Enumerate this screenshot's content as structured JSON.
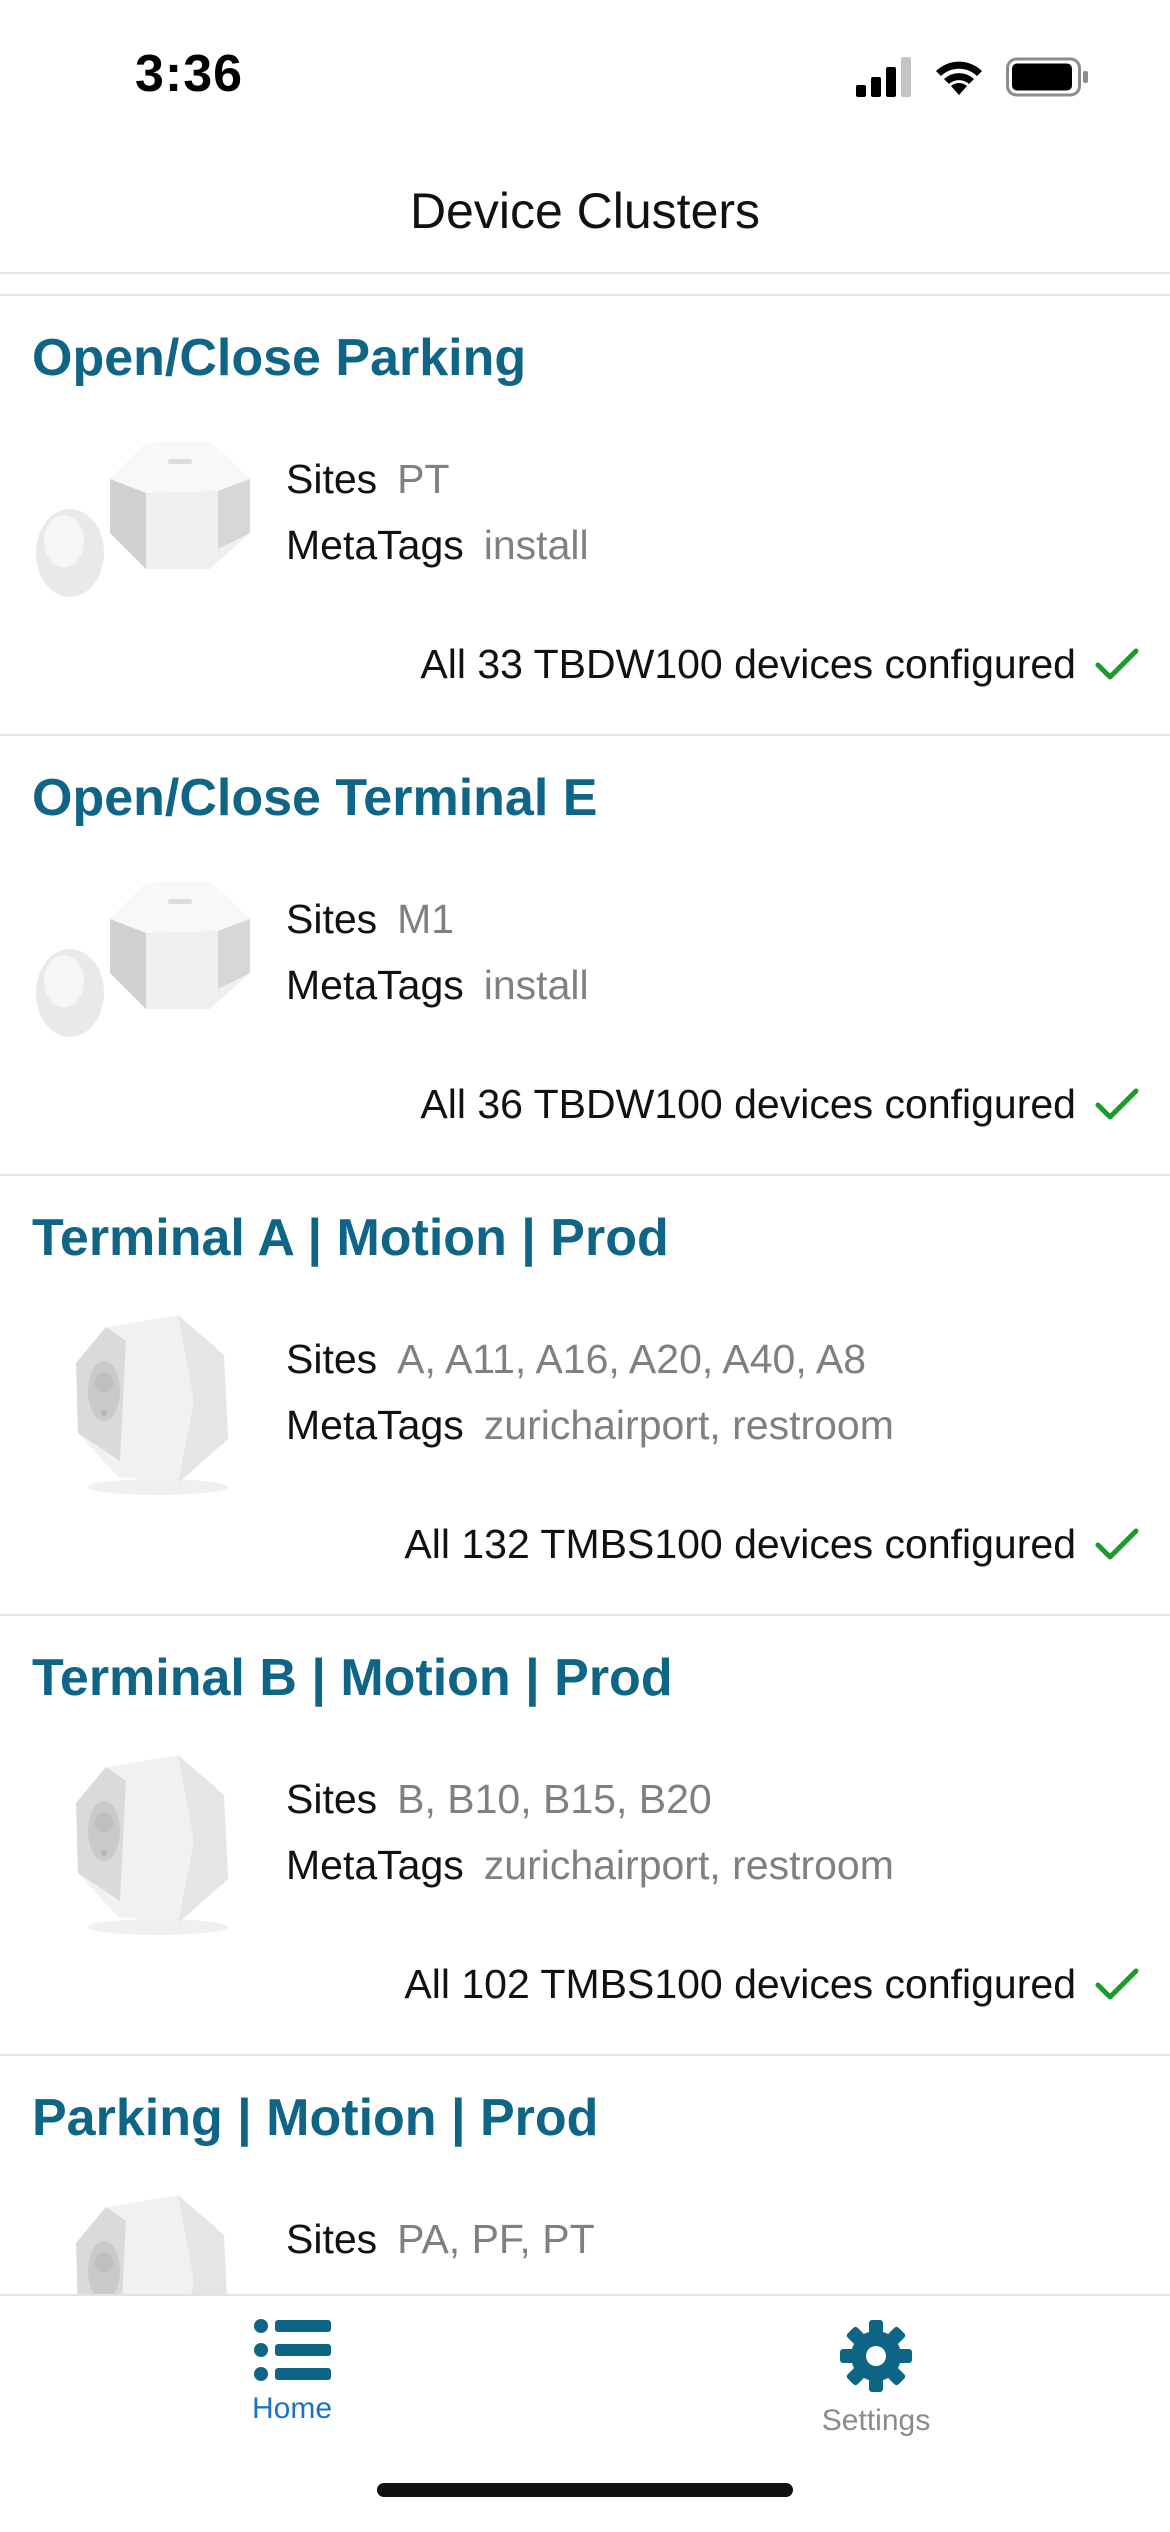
{
  "status_bar": {
    "time": "3:36"
  },
  "header": {
    "title": "Device Clusters"
  },
  "colors": {
    "accent": "#0e6585",
    "check": "#1a9a2a",
    "tab_active": "#1a73c8",
    "tab_inactive": "#8b8b8b"
  },
  "clusters": [
    {
      "title": "Open/Close Parking",
      "device_icon": "open-close-sensor",
      "sites_label": "Sites",
      "sites": "PT",
      "metatags_label": "MetaTags",
      "metatags": "install",
      "status": "All 33 TBDW100 devices configured"
    },
    {
      "title": "Open/Close Terminal E",
      "device_icon": "open-close-sensor",
      "sites_label": "Sites",
      "sites": "M1",
      "metatags_label": "MetaTags",
      "metatags": "install",
      "status": "All 36 TBDW100 devices configured"
    },
    {
      "title": "Terminal A | Motion | Prod",
      "device_icon": "motion-sensor",
      "sites_label": "Sites",
      "sites": "A, A11, A16, A20, A40, A8",
      "metatags_label": "MetaTags",
      "metatags": "zurichairport, restroom",
      "status": "All 132 TMBS100 devices configured"
    },
    {
      "title": "Terminal B | Motion | Prod",
      "device_icon": "motion-sensor",
      "sites_label": "Sites",
      "sites": "B, B10, B15, B20",
      "metatags_label": "MetaTags",
      "metatags": "zurichairport, restroom",
      "status": "All 102 TMBS100 devices configured"
    },
    {
      "title": "Parking | Motion | Prod",
      "device_icon": "motion-sensor",
      "sites_label": "Sites",
      "sites": "PA, PF, PT"
    }
  ],
  "tab_bar": {
    "home_label": "Home",
    "settings_label": "Settings",
    "active": "Home"
  }
}
